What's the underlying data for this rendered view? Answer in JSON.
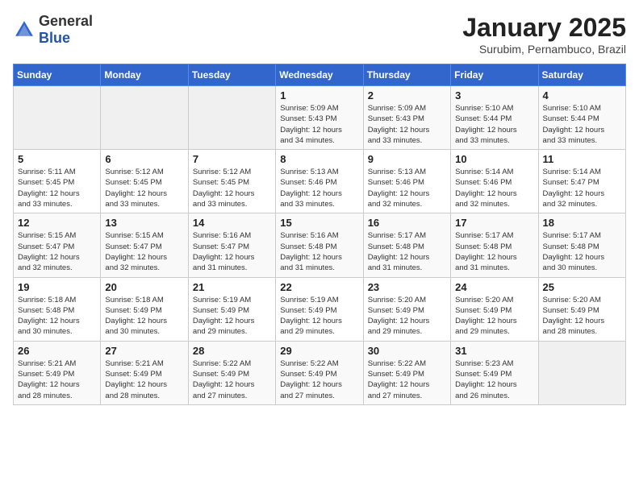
{
  "header": {
    "logo_general": "General",
    "logo_blue": "Blue",
    "month_title": "January 2025",
    "subtitle": "Surubim, Pernambuco, Brazil"
  },
  "weekdays": [
    "Sunday",
    "Monday",
    "Tuesday",
    "Wednesday",
    "Thursday",
    "Friday",
    "Saturday"
  ],
  "weeks": [
    [
      {
        "day": "",
        "info": ""
      },
      {
        "day": "",
        "info": ""
      },
      {
        "day": "",
        "info": ""
      },
      {
        "day": "1",
        "info": "Sunrise: 5:09 AM\nSunset: 5:43 PM\nDaylight: 12 hours\nand 34 minutes."
      },
      {
        "day": "2",
        "info": "Sunrise: 5:09 AM\nSunset: 5:43 PM\nDaylight: 12 hours\nand 33 minutes."
      },
      {
        "day": "3",
        "info": "Sunrise: 5:10 AM\nSunset: 5:44 PM\nDaylight: 12 hours\nand 33 minutes."
      },
      {
        "day": "4",
        "info": "Sunrise: 5:10 AM\nSunset: 5:44 PM\nDaylight: 12 hours\nand 33 minutes."
      }
    ],
    [
      {
        "day": "5",
        "info": "Sunrise: 5:11 AM\nSunset: 5:45 PM\nDaylight: 12 hours\nand 33 minutes."
      },
      {
        "day": "6",
        "info": "Sunrise: 5:12 AM\nSunset: 5:45 PM\nDaylight: 12 hours\nand 33 minutes."
      },
      {
        "day": "7",
        "info": "Sunrise: 5:12 AM\nSunset: 5:45 PM\nDaylight: 12 hours\nand 33 minutes."
      },
      {
        "day": "8",
        "info": "Sunrise: 5:13 AM\nSunset: 5:46 PM\nDaylight: 12 hours\nand 33 minutes."
      },
      {
        "day": "9",
        "info": "Sunrise: 5:13 AM\nSunset: 5:46 PM\nDaylight: 12 hours\nand 32 minutes."
      },
      {
        "day": "10",
        "info": "Sunrise: 5:14 AM\nSunset: 5:46 PM\nDaylight: 12 hours\nand 32 minutes."
      },
      {
        "day": "11",
        "info": "Sunrise: 5:14 AM\nSunset: 5:47 PM\nDaylight: 12 hours\nand 32 minutes."
      }
    ],
    [
      {
        "day": "12",
        "info": "Sunrise: 5:15 AM\nSunset: 5:47 PM\nDaylight: 12 hours\nand 32 minutes."
      },
      {
        "day": "13",
        "info": "Sunrise: 5:15 AM\nSunset: 5:47 PM\nDaylight: 12 hours\nand 32 minutes."
      },
      {
        "day": "14",
        "info": "Sunrise: 5:16 AM\nSunset: 5:47 PM\nDaylight: 12 hours\nand 31 minutes."
      },
      {
        "day": "15",
        "info": "Sunrise: 5:16 AM\nSunset: 5:48 PM\nDaylight: 12 hours\nand 31 minutes."
      },
      {
        "day": "16",
        "info": "Sunrise: 5:17 AM\nSunset: 5:48 PM\nDaylight: 12 hours\nand 31 minutes."
      },
      {
        "day": "17",
        "info": "Sunrise: 5:17 AM\nSunset: 5:48 PM\nDaylight: 12 hours\nand 31 minutes."
      },
      {
        "day": "18",
        "info": "Sunrise: 5:17 AM\nSunset: 5:48 PM\nDaylight: 12 hours\nand 30 minutes."
      }
    ],
    [
      {
        "day": "19",
        "info": "Sunrise: 5:18 AM\nSunset: 5:48 PM\nDaylight: 12 hours\nand 30 minutes."
      },
      {
        "day": "20",
        "info": "Sunrise: 5:18 AM\nSunset: 5:49 PM\nDaylight: 12 hours\nand 30 minutes."
      },
      {
        "day": "21",
        "info": "Sunrise: 5:19 AM\nSunset: 5:49 PM\nDaylight: 12 hours\nand 29 minutes."
      },
      {
        "day": "22",
        "info": "Sunrise: 5:19 AM\nSunset: 5:49 PM\nDaylight: 12 hours\nand 29 minutes."
      },
      {
        "day": "23",
        "info": "Sunrise: 5:20 AM\nSunset: 5:49 PM\nDaylight: 12 hours\nand 29 minutes."
      },
      {
        "day": "24",
        "info": "Sunrise: 5:20 AM\nSunset: 5:49 PM\nDaylight: 12 hours\nand 29 minutes."
      },
      {
        "day": "25",
        "info": "Sunrise: 5:20 AM\nSunset: 5:49 PM\nDaylight: 12 hours\nand 28 minutes."
      }
    ],
    [
      {
        "day": "26",
        "info": "Sunrise: 5:21 AM\nSunset: 5:49 PM\nDaylight: 12 hours\nand 28 minutes."
      },
      {
        "day": "27",
        "info": "Sunrise: 5:21 AM\nSunset: 5:49 PM\nDaylight: 12 hours\nand 28 minutes."
      },
      {
        "day": "28",
        "info": "Sunrise: 5:22 AM\nSunset: 5:49 PM\nDaylight: 12 hours\nand 27 minutes."
      },
      {
        "day": "29",
        "info": "Sunrise: 5:22 AM\nSunset: 5:49 PM\nDaylight: 12 hours\nand 27 minutes."
      },
      {
        "day": "30",
        "info": "Sunrise: 5:22 AM\nSunset: 5:49 PM\nDaylight: 12 hours\nand 27 minutes."
      },
      {
        "day": "31",
        "info": "Sunrise: 5:23 AM\nSunset: 5:49 PM\nDaylight: 12 hours\nand 26 minutes."
      },
      {
        "day": "",
        "info": ""
      }
    ]
  ]
}
